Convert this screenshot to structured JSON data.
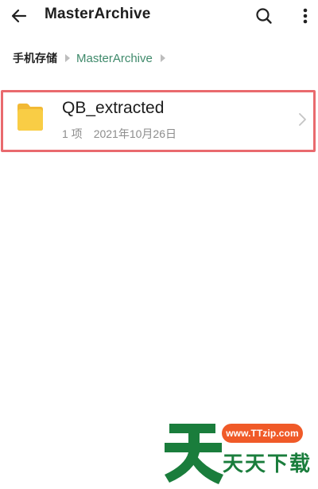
{
  "topbar": {
    "title": "MasterArchive",
    "icons": {
      "back": "arrow-left-icon",
      "search": "search-icon",
      "more": "more-vertical-icon"
    }
  },
  "breadcrumb": {
    "root": "手机存储",
    "current": "MasterArchive"
  },
  "files": [
    {
      "name": "QB_extracted",
      "count": "1 项",
      "date": "2021年10月26日",
      "icon": "folder-icon"
    }
  ],
  "watermark": {
    "url": "www.TTzip.com",
    "chars": "天天下载"
  },
  "colors": {
    "accent": "#3f8a6b",
    "folder": "#f9cd45",
    "highlight": "#e96a6e",
    "watermark_green": "#1a7d3c",
    "watermark_orange": "#f05a28"
  }
}
